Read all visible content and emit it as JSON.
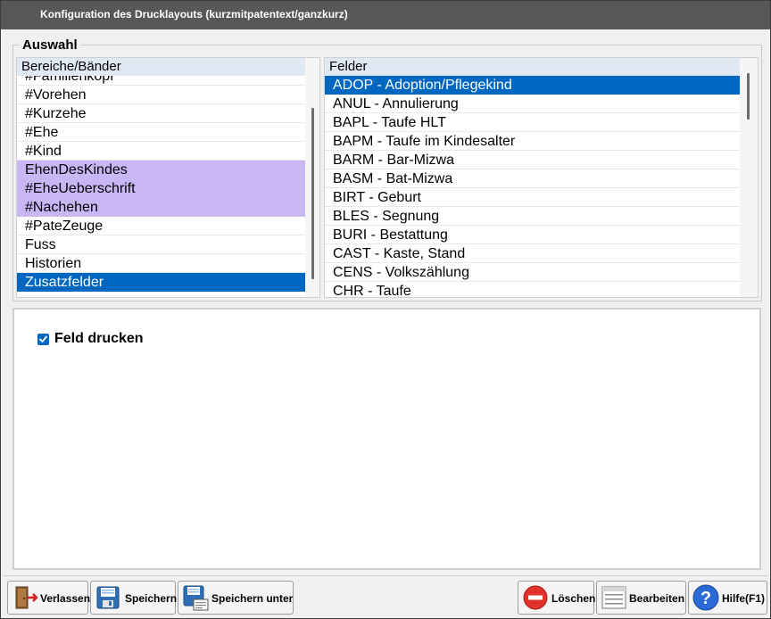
{
  "window": {
    "title": "Konfiguration des Drucklayouts (kurzmitpatentext/ganzkurz)"
  },
  "group": {
    "legend": "Auswahl"
  },
  "left_list": {
    "header": "Bereiche/Bänder",
    "items": [
      {
        "label": "#Familienkopf",
        "state": "normal"
      },
      {
        "label": "#Vorehen",
        "state": "normal"
      },
      {
        "label": "#Kurzehe",
        "state": "normal"
      },
      {
        "label": "#Ehe",
        "state": "normal"
      },
      {
        "label": "#Kind",
        "state": "normal"
      },
      {
        "label": "EhenDesKindes",
        "state": "highlighted"
      },
      {
        "label": "#EheUeberschrift",
        "state": "highlighted"
      },
      {
        "label": "#Nachehen",
        "state": "highlighted"
      },
      {
        "label": "#PateZeuge",
        "state": "normal"
      },
      {
        "label": "Fuss",
        "state": "normal"
      },
      {
        "label": "Historien",
        "state": "normal"
      },
      {
        "label": "Zusatzfelder",
        "state": "selected"
      }
    ]
  },
  "right_list": {
    "header": "Felder",
    "items": [
      {
        "label": "ADOP - Adoption/Pflegekind",
        "state": "selected"
      },
      {
        "label": "ANUL - Annulierung",
        "state": "normal"
      },
      {
        "label": "BAPL - Taufe HLT",
        "state": "normal"
      },
      {
        "label": "BAPM - Taufe im Kindesalter",
        "state": "normal"
      },
      {
        "label": "BARM - Bar-Mizwa",
        "state": "normal"
      },
      {
        "label": "BASM - Bat-Mizwa",
        "state": "normal"
      },
      {
        "label": "BIRT - Geburt",
        "state": "normal"
      },
      {
        "label": "BLES - Segnung",
        "state": "normal"
      },
      {
        "label": "BURI - Bestattung",
        "state": "normal"
      },
      {
        "label": "CAST - Kaste, Stand",
        "state": "normal"
      },
      {
        "label": "CENS - Volkszählung",
        "state": "normal"
      },
      {
        "label": "CHR - Taufe",
        "state": "normal"
      }
    ]
  },
  "options": {
    "print_field_label": "Feld drucken",
    "print_field_checked": true
  },
  "buttons": {
    "exit": "Verlassen",
    "save": "Speichern",
    "save_as": "Speichern unter",
    "delete": "Löschen",
    "edit": "Bearbeiten",
    "help": "Hilfe(F1)"
  },
  "colors": {
    "titlebar": "#575757",
    "selection": "#0067c0",
    "highlight": "#c8b6f5",
    "header": "#e0e8f4"
  }
}
